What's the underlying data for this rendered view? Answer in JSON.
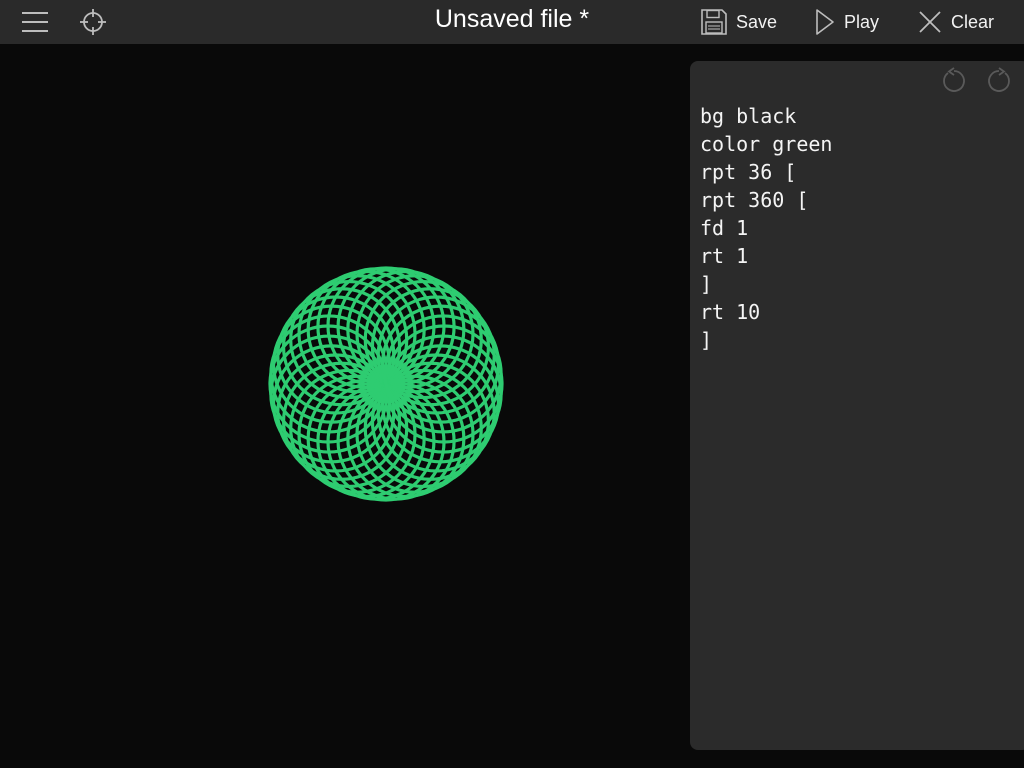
{
  "toolbar": {
    "menu_icon": "hamburger-menu-icon",
    "target_icon": "crosshair-icon",
    "title": "Unsaved file *",
    "save": {
      "label": "Save",
      "icon": "floppy-disk-icon"
    },
    "play": {
      "label": "Play",
      "icon": "play-triangle-icon"
    },
    "clear": {
      "label": "Clear",
      "icon": "x-close-icon"
    }
  },
  "canvas": {
    "background": "#090909",
    "stroke_color": "#2ecc71",
    "spirograph": {
      "repeat_outer": 36,
      "turn_outer_deg": 10,
      "repeat_inner": 360,
      "step": 1,
      "turn_inner_deg": 1
    }
  },
  "editor": {
    "undo_icon": "undo-icon",
    "redo_icon": "redo-icon",
    "code": "bg black\ncolor green\nrpt 36 [\nrpt 360 [\nfd 1\nrt 1\n]\nrt 10\n]"
  }
}
